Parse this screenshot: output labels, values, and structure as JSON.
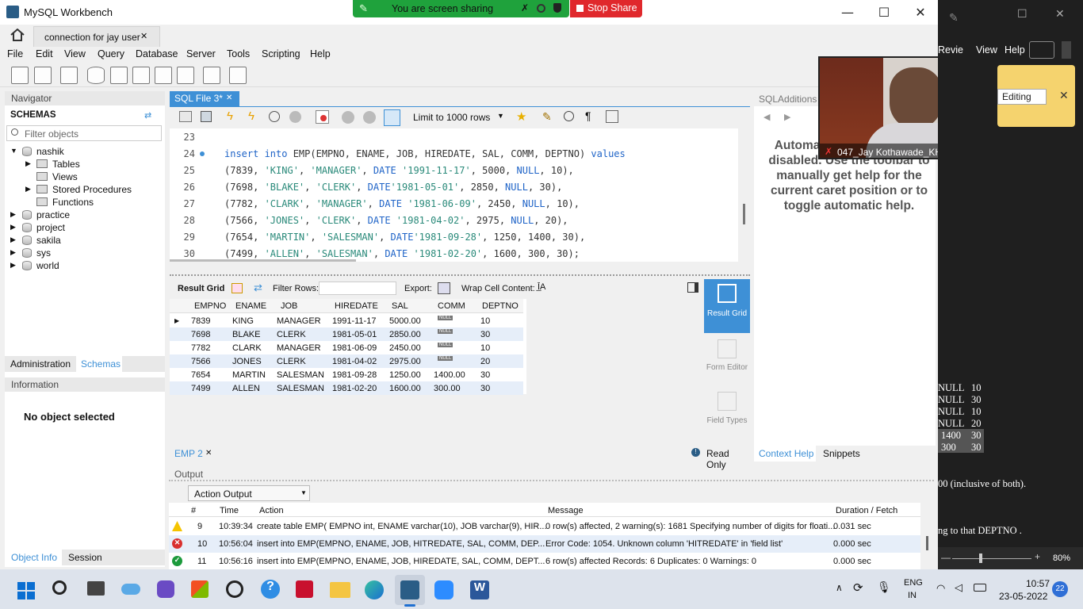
{
  "window": {
    "title": "MySQL Workbench",
    "min": "—",
    "max": "☐",
    "close": "✕"
  },
  "sharing": {
    "text": "You are screen sharing",
    "stop": "Stop Share"
  },
  "conn_tab": {
    "label": "connection for jay user",
    "close": "✕"
  },
  "menu": [
    "File",
    "Edit",
    "View",
    "Query",
    "Database",
    "Server",
    "Tools",
    "Scripting",
    "Help"
  ],
  "navigator": {
    "header": "Navigator",
    "schemas_title": "SCHEMAS",
    "filter_placeholder": "Filter objects",
    "schemas": [
      {
        "name": "nashik",
        "expanded": true,
        "children": [
          "Tables",
          "Views",
          "Stored Procedures",
          "Functions"
        ]
      },
      {
        "name": "practice"
      },
      {
        "name": "project"
      },
      {
        "name": "sakila"
      },
      {
        "name": "sys"
      },
      {
        "name": "world"
      }
    ],
    "tabs": [
      "Administration",
      "Schemas"
    ],
    "info_header": "Information",
    "no_object": "No object selected",
    "bottom_tabs": [
      "Object Info",
      "Session"
    ]
  },
  "editor": {
    "tab": "SQL File 3*",
    "tab_close": "✕",
    "limit": "Limit to 1000 rows",
    "lines": [
      {
        "n": "23",
        "tokens": []
      },
      {
        "n": "24",
        "tokens": [
          [
            "kw",
            "insert into"
          ],
          [
            "p",
            " EMP(EMPNO, ENAME, JOB, HIREDATE, SAL, COMM, DEPTNO) "
          ],
          [
            "kw",
            "values"
          ]
        ]
      },
      {
        "n": "25",
        "tokens": [
          [
            "p",
            "(7839, "
          ],
          [
            "str",
            "'KING'"
          ],
          [
            "p",
            ", "
          ],
          [
            "str",
            "'MANAGER'"
          ],
          [
            "p",
            ", "
          ],
          [
            "kw",
            "DATE"
          ],
          [
            "p",
            " "
          ],
          [
            "str",
            "'1991-11-17'"
          ],
          [
            "p",
            ", 5000, "
          ],
          [
            "kw",
            "NULL"
          ],
          [
            "p",
            ", 10),"
          ]
        ]
      },
      {
        "n": "26",
        "tokens": [
          [
            "p",
            "(7698, "
          ],
          [
            "str",
            "'BLAKE'"
          ],
          [
            "p",
            ", "
          ],
          [
            "str",
            "'CLERK'"
          ],
          [
            "p",
            ", "
          ],
          [
            "kw",
            "DATE"
          ],
          [
            "str",
            "'1981-05-01'"
          ],
          [
            "p",
            ", 2850, "
          ],
          [
            "kw",
            "NULL"
          ],
          [
            "p",
            ", 30),"
          ]
        ]
      },
      {
        "n": "27",
        "tokens": [
          [
            "p",
            "(7782, "
          ],
          [
            "str",
            "'CLARK'"
          ],
          [
            "p",
            ", "
          ],
          [
            "str",
            "'MANAGER'"
          ],
          [
            "p",
            ", "
          ],
          [
            "kw",
            "DATE"
          ],
          [
            "p",
            " "
          ],
          [
            "str",
            "'1981-06-09'"
          ],
          [
            "p",
            ", 2450, "
          ],
          [
            "kw",
            "NULL"
          ],
          [
            "p",
            ", 10),"
          ]
        ]
      },
      {
        "n": "28",
        "tokens": [
          [
            "p",
            "(7566, "
          ],
          [
            "str",
            "'JONES'"
          ],
          [
            "p",
            ", "
          ],
          [
            "str",
            "'CLERK'"
          ],
          [
            "p",
            ", "
          ],
          [
            "kw",
            "DATE"
          ],
          [
            "p",
            " "
          ],
          [
            "str",
            "'1981-04-02'"
          ],
          [
            "p",
            ", 2975, "
          ],
          [
            "kw",
            "NULL"
          ],
          [
            "p",
            ", 20),"
          ]
        ]
      },
      {
        "n": "29",
        "tokens": [
          [
            "p",
            "(7654, "
          ],
          [
            "str",
            "'MARTIN'"
          ],
          [
            "p",
            ", "
          ],
          [
            "str",
            "'SALESMAN'"
          ],
          [
            "p",
            ", "
          ],
          [
            "kw",
            "DATE"
          ],
          [
            "str",
            "'1981-09-28'"
          ],
          [
            "p",
            ", 1250, 1400, 30),"
          ]
        ]
      },
      {
        "n": "30",
        "tokens": [
          [
            "p",
            "(7499, "
          ],
          [
            "str",
            "'ALLEN'"
          ],
          [
            "p",
            ", "
          ],
          [
            "str",
            "'SALESMAN'"
          ],
          [
            "p",
            ", "
          ],
          [
            "kw",
            "DATE"
          ],
          [
            "p",
            " "
          ],
          [
            "str",
            "'1981-02-20'"
          ],
          [
            "p",
            ", 1600, 300, 30);"
          ]
        ]
      }
    ]
  },
  "results": {
    "toolbar": {
      "result_grid": "Result Grid",
      "filter": "Filter Rows:",
      "export": "Export:",
      "wrap": "Wrap Cell Content:"
    },
    "columns": [
      "EMPNO",
      "ENAME",
      "JOB",
      "HIREDATE",
      "SAL",
      "COMM",
      "DEPTNO"
    ],
    "rows": [
      [
        "7839",
        "KING",
        "MANAGER",
        "1991-11-17",
        "5000.00",
        "NULL",
        "10"
      ],
      [
        "7698",
        "BLAKE",
        "CLERK",
        "1981-05-01",
        "2850.00",
        "NULL",
        "30"
      ],
      [
        "7782",
        "CLARK",
        "MANAGER",
        "1981-06-09",
        "2450.00",
        "NULL",
        "10"
      ],
      [
        "7566",
        "JONES",
        "CLERK",
        "1981-04-02",
        "2975.00",
        "NULL",
        "20"
      ],
      [
        "7654",
        "MARTIN",
        "SALESMAN",
        "1981-09-28",
        "1250.00",
        "1400.00",
        "30"
      ],
      [
        "7499",
        "ALLEN",
        "SALESMAN",
        "1981-02-20",
        "1600.00",
        "300.00",
        "30"
      ]
    ],
    "side": [
      "Result Grid",
      "Form Editor",
      "Field Types"
    ],
    "bottom_tab": "EMP 2",
    "readonly": "Read Only"
  },
  "sql_additions": {
    "header": "SQLAdditions",
    "help_text": "Automatic context help is disabled. Use the toolbar to manually get help for the current caret position or to toggle automatic help.",
    "tabs": [
      "Context Help",
      "Snippets"
    ]
  },
  "output": {
    "header": "Output",
    "selector": "Action Output",
    "columns": [
      "#",
      "Time",
      "Action",
      "Message",
      "Duration / Fetch"
    ],
    "rows": [
      {
        "status": "warn",
        "n": "9",
        "time": "10:39:34",
        "action": "create table EMP( EMPNO int, ENAME varchar(10), JOB varchar(9), HIR...",
        "message": "0 row(s) affected, 2 warning(s): 1681 Specifying number of digits for floati...",
        "dur": "0.031 sec"
      },
      {
        "status": "error",
        "n": "10",
        "time": "10:56:04",
        "action": "insert into EMP(EMPNO, ENAME, JOB, HITREDATE, SAL, COMM, DEP...",
        "message": "Error Code: 1054. Unknown column 'HITREDATE' in 'field list'",
        "dur": "0.000 sec"
      },
      {
        "status": "ok",
        "n": "11",
        "time": "10:56:16",
        "action": "insert into EMP(EMPNO, ENAME, JOB, HIREDATE, SAL, COMM, DEPT...",
        "message": "6 row(s) affected Records: 6  Duplicates: 0  Warnings: 0",
        "dur": "0.000 sec"
      }
    ]
  },
  "video": {
    "name": "047_Jay Kothawade_KH"
  },
  "dark_app": {
    "menu": [
      "Revie",
      "View",
      "Help"
    ],
    "editing": "Editing",
    "table": [
      [
        "NULL",
        "10"
      ],
      [
        "NULL",
        "30"
      ],
      [
        "NULL",
        "10"
      ],
      [
        "NULL",
        "20"
      ],
      [
        "1400",
        "30"
      ],
      [
        "300",
        "30"
      ]
    ],
    "text1": "00 (inclusive of both).",
    "text2": "ng to that DEPTNO .",
    "zoom": "80%"
  },
  "taskbar": {
    "lang1": "ENG",
    "lang2": "IN",
    "time": "10:57",
    "date": "23-05-2022",
    "badge": "22"
  },
  "colors": {
    "accent": "#3e90d6",
    "share_green": "#1fa23c",
    "stop_red": "#e0282c"
  }
}
